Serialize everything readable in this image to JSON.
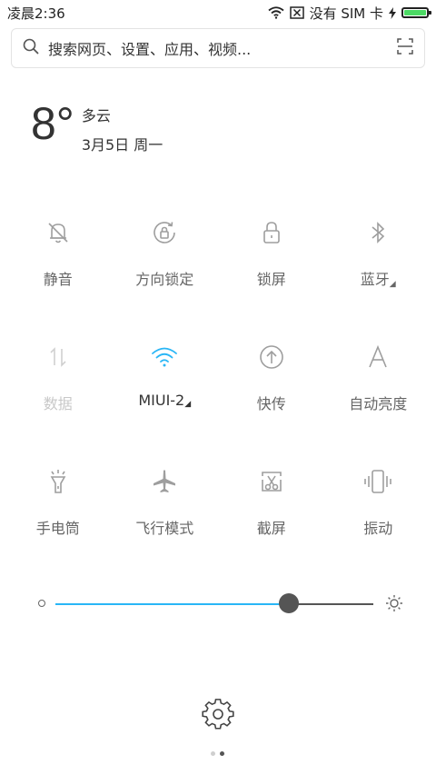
{
  "status_bar": {
    "time": "凌晨2:36",
    "sim_text": "没有 SIM 卡",
    "battery_level_percent": 100,
    "icons": [
      "wifi-icon",
      "sim-x-icon",
      "charging-icon",
      "battery-icon"
    ]
  },
  "search": {
    "placeholder": "搜索网页、设置、应用、视频..."
  },
  "weather": {
    "temperature": "8°",
    "condition": "多云",
    "date": "3月5日 周一"
  },
  "toggles": [
    {
      "label": "静音",
      "icon": "bell-off-icon",
      "state": "off"
    },
    {
      "label": "方向锁定",
      "icon": "rotation-lock-icon",
      "state": "off"
    },
    {
      "label": "锁屏",
      "icon": "lock-icon",
      "state": "off"
    },
    {
      "label": "蓝牙",
      "icon": "bluetooth-icon",
      "state": "off",
      "has_more": true
    },
    {
      "label": "数据",
      "icon": "mobile-data-icon",
      "state": "disabled"
    },
    {
      "label": "MIUI-2",
      "icon": "wifi-icon",
      "state": "on",
      "has_more": true
    },
    {
      "label": "快传",
      "icon": "upload-circle-icon",
      "state": "off"
    },
    {
      "label": "自动亮度",
      "icon": "auto-brightness-icon",
      "state": "off"
    },
    {
      "label": "手电筒",
      "icon": "flashlight-icon",
      "state": "off"
    },
    {
      "label": "飞行模式",
      "icon": "airplane-icon",
      "state": "off"
    },
    {
      "label": "截屏",
      "icon": "screenshot-icon",
      "state": "off"
    },
    {
      "label": "振动",
      "icon": "vibrate-icon",
      "state": "off"
    }
  ],
  "brightness": {
    "level_fraction": 0.734
  },
  "colors": {
    "accent": "#29b6f6",
    "icon_gray": "#9e9e9e",
    "disabled": "#d0d0d0",
    "battery_green": "#4cd964"
  },
  "pager": {
    "pages": 2,
    "current": 2
  }
}
